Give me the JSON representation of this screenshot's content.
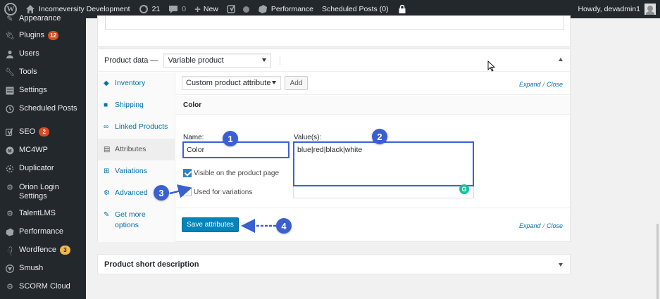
{
  "adminbar": {
    "site_name": "Incomeversity Development",
    "updates_count": "21",
    "comments_count": "0",
    "new_label": "New",
    "performance_label": "Performance",
    "scheduled_posts_label": "Scheduled Posts (0)",
    "howdy": "Howdy, devadmin1"
  },
  "sidebar": {
    "items": [
      {
        "label": "Appearance",
        "icon": "paintbrush-icon"
      },
      {
        "label": "Plugins",
        "icon": "plugin-icon",
        "badge": "12"
      },
      {
        "label": "Users",
        "icon": "user-icon"
      },
      {
        "label": "Tools",
        "icon": "wrench-icon"
      },
      {
        "label": "Settings",
        "icon": "settings-icon"
      },
      {
        "label": "Scheduled Posts",
        "icon": "clock-icon"
      },
      {
        "label": "SEO",
        "icon": "yoast-icon",
        "badge": "2"
      },
      {
        "label": "MC4WP",
        "icon": "mc4wp-icon"
      },
      {
        "label": "Duplicator",
        "icon": "duplicator-icon"
      },
      {
        "label": "Orion Login Settings",
        "icon": "gear-icon"
      },
      {
        "label": "TalentLMS",
        "icon": "gear-icon"
      },
      {
        "label": "Performance",
        "icon": "performance-icon"
      },
      {
        "label": "Wordfence",
        "icon": "wordfence-icon",
        "badge": "3"
      },
      {
        "label": "Smush",
        "icon": "smush-icon"
      },
      {
        "label": "SCORM Cloud",
        "icon": "gear-icon"
      }
    ]
  },
  "product_data": {
    "label": "Product data —",
    "type_value": "Variable product",
    "tabs": [
      {
        "label": "Inventory",
        "icon": "tag-icon"
      },
      {
        "label": "Shipping",
        "icon": "truck-icon"
      },
      {
        "label": "Linked Products",
        "icon": "link-icon"
      },
      {
        "label": "Attributes",
        "icon": "list-icon"
      },
      {
        "label": "Variations",
        "icon": "grid-icon"
      },
      {
        "label": "Advanced",
        "icon": "gear-icon"
      },
      {
        "label": "Get more options",
        "icon": "plugin-icon"
      }
    ],
    "attribute_select": "Custom product attribute",
    "add_label": "Add",
    "expand_label": "Expand",
    "close_label": "Close",
    "slash": "/",
    "attribute_title": "Color",
    "name_label": "Name:",
    "name_value": "Color",
    "values_label": "Value(s):",
    "values_value": "blue|red|black|white",
    "visible_label": "Visible on the product page",
    "variations_label": "Used for variations",
    "save_label": "Save attributes"
  },
  "short_description": {
    "label": "Product short description"
  },
  "callouts": [
    "1",
    "2",
    "3",
    "4"
  ],
  "colors": {
    "admin_dark": "#23282d",
    "link_blue": "#0073aa",
    "primary_button": "#0085ba",
    "callout_blue": "#3a5fd0"
  }
}
